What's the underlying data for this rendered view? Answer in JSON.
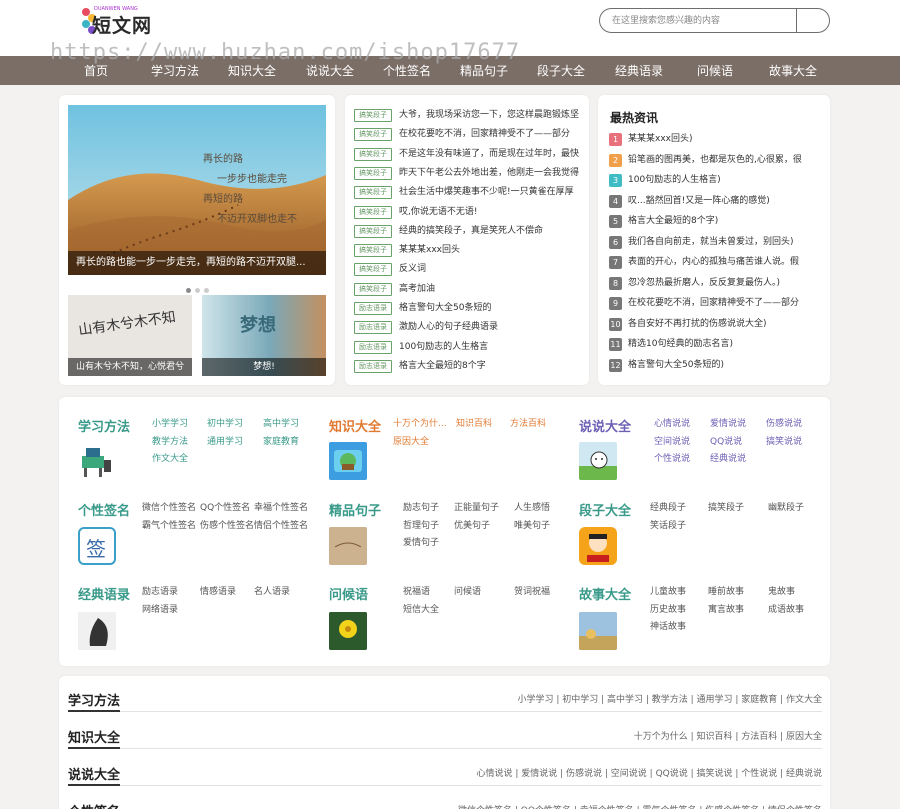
{
  "header": {
    "logo_text": "短文网",
    "logo_sub": "DUANWEN WANG",
    "watermark": "https://www.huzhan.com/ishop17677",
    "search_placeholder": "在这里搜索您感兴趣的内容"
  },
  "nav": [
    "首页",
    "学习方法",
    "知识大全",
    "说说大全",
    "个性签名",
    "精品句子",
    "段子大全",
    "经典语录",
    "问候语",
    "故事大全"
  ],
  "slider": {
    "caption": "再长的路也能一步一步走完，再短的路不迈开双腿...",
    "image_text": [
      "再长的路",
      "一步步也能走完",
      "再短的路",
      "不迈开双脚也走不"
    ],
    "thumbs": [
      {
        "caption": "山有木兮木不知，心悦君兮",
        "image_text": "山有木兮木不知"
      },
      {
        "caption": "梦想!",
        "image_text": "梦想"
      }
    ]
  },
  "jokes": [
    {
      "tag": "搞笑段子",
      "text": "大爷，我现场采访您一下，您这样晨跑锻炼坚"
    },
    {
      "tag": "搞笑段子",
      "text": "在校花要吃不消，回家精神受不了——部分"
    },
    {
      "tag": "搞笑段子",
      "text": "不是这年没有味道了，而是现在过年时，最快"
    },
    {
      "tag": "搞笑段子",
      "text": "昨天下午老公去外地出差，他刚走一会我觉得"
    },
    {
      "tag": "搞笑段子",
      "text": "社会生活中爆笑趣事不少呢!一只黄雀在厚厚"
    },
    {
      "tag": "搞笑段子",
      "text": "哎,你说无语不无语!"
    },
    {
      "tag": "搞笑段子",
      "text": "经典的搞笑段子，真是笑死人不偿命"
    },
    {
      "tag": "搞笑段子",
      "text": "某某某xxx回头"
    },
    {
      "tag": "搞笑段子",
      "text": "反义词"
    },
    {
      "tag": "搞笑段子",
      "text": "高考加油"
    },
    {
      "tag": "励志语录",
      "text": "格言警句大全50条短的"
    },
    {
      "tag": "励志语录",
      "text": "激励人心的句子经典语录"
    },
    {
      "tag": "励志语录",
      "text": "100句励志的人生格言"
    },
    {
      "tag": "励志语录",
      "text": "格言大全最短的8个字"
    }
  ],
  "hot": {
    "title": "最热资讯",
    "items": [
      {
        "num": "1",
        "text": "某某某xxx回头)",
        "color": "#e8717c"
      },
      {
        "num": "2",
        "text": "铅笔画的图再美，也都是灰色的,心很累，很",
        "color": "#f0a04b"
      },
      {
        "num": "3",
        "text": "100句励志的人生格言)",
        "color": "#3fbcc4"
      },
      {
        "num": "4",
        "text": "叹...豁然回首!又是一阵心痛的感觉)",
        "color": "#777"
      },
      {
        "num": "5",
        "text": "格言大全最短的8个字)",
        "color": "#777"
      },
      {
        "num": "6",
        "text": "我们各自向前走，就当未曾爱过，别回头)",
        "color": "#777"
      },
      {
        "num": "7",
        "text": "表面的开心，内心的孤独与痛苦谁人说。假",
        "color": "#777"
      },
      {
        "num": "8",
        "text": "忽冷忽热最折磨人，反反复复最伤人。)",
        "color": "#777"
      },
      {
        "num": "9",
        "text": "在校花要吃不消，回家精神受不了——部分",
        "color": "#777"
      },
      {
        "num": "10",
        "text": "各自安好不再打扰的伤感说说大全)",
        "color": "#777"
      },
      {
        "num": "11",
        "text": "精选10句经典的励志名言)",
        "color": "#777"
      },
      {
        "num": "12",
        "text": "格言警句大全50条短的)",
        "color": "#777"
      }
    ]
  },
  "categories": [
    {
      "title": "学习方法",
      "color": "#3a9a8a",
      "link_color": "#3a9a8a",
      "links": [
        "小学学习",
        "初中学习",
        "高中学习",
        "教学方法",
        "通用学习",
        "家庭教育",
        "作文大全"
      ]
    },
    {
      "title": "知识大全",
      "color": "#e07a32",
      "link_color": "#e07a32",
      "links": [
        "十万个为什...",
        "知识百科",
        "方法百科",
        "原因大全"
      ]
    },
    {
      "title": "说说大全",
      "color": "#6c5fb4",
      "link_color": "#6c5fb4",
      "links": [
        "心情说说",
        "爱情说说",
        "伤感说说",
        "空间说说",
        "QQ说说",
        "搞笑说说",
        "个性说说",
        "经典说说"
      ]
    },
    {
      "title": "个性签名",
      "color": "#3a9a8a",
      "link_color": "#555",
      "links": [
        "微信个性签名",
        "QQ个性签名",
        "幸福个性签名",
        "霸气个性签名",
        "伤感个性签名",
        "情侣个性签名"
      ]
    },
    {
      "title": "精品句子",
      "color": "#3a9a8a",
      "link_color": "#555",
      "links": [
        "励志句子",
        "正能量句子",
        "人生感悟",
        "哲理句子",
        "优美句子",
        "唯美句子",
        "爱情句子"
      ]
    },
    {
      "title": "段子大全",
      "color": "#3a9a8a",
      "link_color": "#555",
      "links": [
        "经典段子",
        "搞笑段子",
        "幽默段子",
        "笑话段子"
      ]
    },
    {
      "title": "经典语录",
      "color": "#3a9a8a",
      "link_color": "#555",
      "links": [
        "励志语录",
        "情感语录",
        "名人语录",
        "网络语录"
      ]
    },
    {
      "title": "问候语",
      "color": "#3a9a8a",
      "link_color": "#555",
      "links": [
        "祝福语",
        "问候语",
        "贺词祝福",
        "短信大全"
      ]
    },
    {
      "title": "故事大全",
      "color": "#3a9a8a",
      "link_color": "#555",
      "links": [
        "儿童故事",
        "睡前故事",
        "鬼故事",
        "历史故事",
        "寓言故事",
        "成语故事",
        "神话故事"
      ]
    }
  ],
  "sections": [
    {
      "title": "学习方法",
      "links": "小学学习 | 初中学习 | 高中学习 | 教学方法 | 通用学习 | 家庭教育 | 作文大全"
    },
    {
      "title": "知识大全",
      "links": "十万个为什么 | 知识百科 | 方法百科 | 原因大全"
    },
    {
      "title": "说说大全",
      "links": "心情说说 | 爱情说说 | 伤感说说 | 空间说说 | QQ说说 | 搞笑说说 | 个性说说 | 经典说说"
    },
    {
      "title": "个性签名",
      "links": "微信个性签名 | QQ个性签名 | 幸福个性签名 | 霸气个性签名 | 伤感个性签名 | 情侣个性签名"
    }
  ],
  "colors": {
    "nav": "#7b6e67",
    "accent": "#3a9a8a"
  }
}
